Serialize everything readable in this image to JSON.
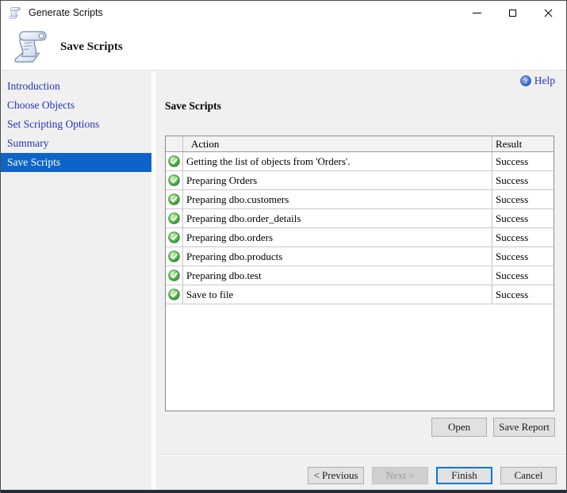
{
  "window": {
    "title": "Generate Scripts"
  },
  "header": {
    "title": "Save Scripts"
  },
  "icons": {
    "app": "scroll-icon",
    "help": "question-circle-icon",
    "help_glyph": "?",
    "row_status": "green-check-icon",
    "window_controls": [
      "minimize-icon",
      "maximize-icon",
      "close-icon"
    ]
  },
  "sidebar": {
    "items": [
      {
        "label": "Introduction",
        "selected": false
      },
      {
        "label": "Choose Objects",
        "selected": false
      },
      {
        "label": "Set Scripting Options",
        "selected": false
      },
      {
        "label": "Summary",
        "selected": false
      },
      {
        "label": "Save Scripts",
        "selected": true
      }
    ]
  },
  "main": {
    "help_label": "Help",
    "section_title": "Save Scripts",
    "table": {
      "columns": [
        "Action",
        "Result"
      ],
      "rows": [
        {
          "action": "Getting the list of objects from 'Orders'.",
          "result": "Success"
        },
        {
          "action": "Preparing Orders",
          "result": "Success"
        },
        {
          "action": "Preparing dbo.customers",
          "result": "Success"
        },
        {
          "action": "Preparing dbo.order_details",
          "result": "Success"
        },
        {
          "action": "Preparing dbo.orders",
          "result": "Success"
        },
        {
          "action": "Preparing dbo.products",
          "result": "Success"
        },
        {
          "action": "Preparing dbo.test",
          "result": "Success"
        },
        {
          "action": "Save to file",
          "result": "Success"
        }
      ]
    },
    "buttons": {
      "open": "Open",
      "save_report": "Save Report",
      "previous": "< Previous",
      "next": "Next >",
      "finish": "Finish",
      "cancel": "Cancel"
    }
  },
  "colors": {
    "selected_step_blue": "#0d64c8",
    "link_blue": "#2233bb",
    "success_green": "#3da23d",
    "focus_border_blue": "#0078d7",
    "window_bg": "#f0f0f0",
    "bottom_edge": "#252d3c"
  }
}
